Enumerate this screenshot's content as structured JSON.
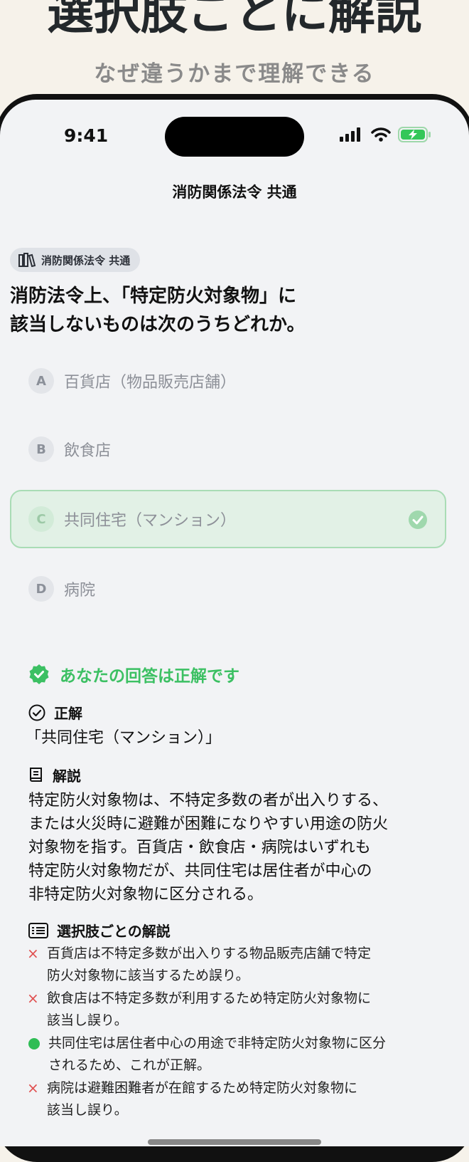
{
  "promo": {
    "title": "選択肢ごとに解説",
    "subtitle": "なぜ違うかまで理解できる"
  },
  "status_bar": {
    "time": "9:41",
    "icons": [
      "cellular-signal-icon",
      "wifi-icon",
      "battery-charging-icon"
    ],
    "battery_color": "#34c759"
  },
  "nav": {
    "title": "消防関係法令 共通"
  },
  "category": {
    "icon": "books-icon",
    "label": "消防関係法令 共通"
  },
  "question": {
    "line1": "消防法令上、「特定防火対象物」に",
    "line2": "該当しないものは次のうちどれか。"
  },
  "options": [
    {
      "letter": "A",
      "text": "百貨店（物品販売店舗）",
      "state": "normal"
    },
    {
      "letter": "B",
      "text": "飲食店",
      "state": "normal"
    },
    {
      "letter": "C",
      "text": "共同住宅（マンション）",
      "state": "correct"
    },
    {
      "letter": "D",
      "text": "病院",
      "state": "normal"
    }
  ],
  "result": {
    "icon": "verified-badge-icon",
    "text": "あなたの回答は正解です",
    "color": "#3cc063"
  },
  "answer": {
    "icon": "check-circle-icon",
    "heading": "正解",
    "text": "「共同住宅（マンション）」"
  },
  "explanation": {
    "icon": "book-icon",
    "heading": "解説",
    "lines": [
      "特定防火対象物は、不特定多数の者が出入りする、",
      "または火災時に避難が困難になりやすい用途の防火",
      "対象物を指す。百貨店・飲食店・病院はいずれも",
      "特定防火対象物だが、共同住宅は居住者が中心の",
      "非特定防火対象物に区分される。"
    ]
  },
  "choice_explanations": {
    "icon": "list-icon",
    "heading": "選択肢ごとの解説",
    "items": [
      {
        "mark": "×",
        "correct": false,
        "lines": [
          "百貨店は不特定多数が出入りする物品販売店舗で特定",
          "防火対象物に該当するため誤り。"
        ]
      },
      {
        "mark": "×",
        "correct": false,
        "lines": [
          "飲食店は不特定多数が利用するため特定防火対象物に",
          "該当し誤り。"
        ]
      },
      {
        "mark": "",
        "correct": true,
        "lines": [
          "共同住宅は居住者中心の用途で非特定防火対象物に区分",
          "されるため、これが正解。"
        ]
      },
      {
        "mark": "×",
        "correct": false,
        "lines": [
          "病院は避難困難者が在館するため特定防火対象物に",
          "該当し誤り。"
        ]
      }
    ]
  }
}
